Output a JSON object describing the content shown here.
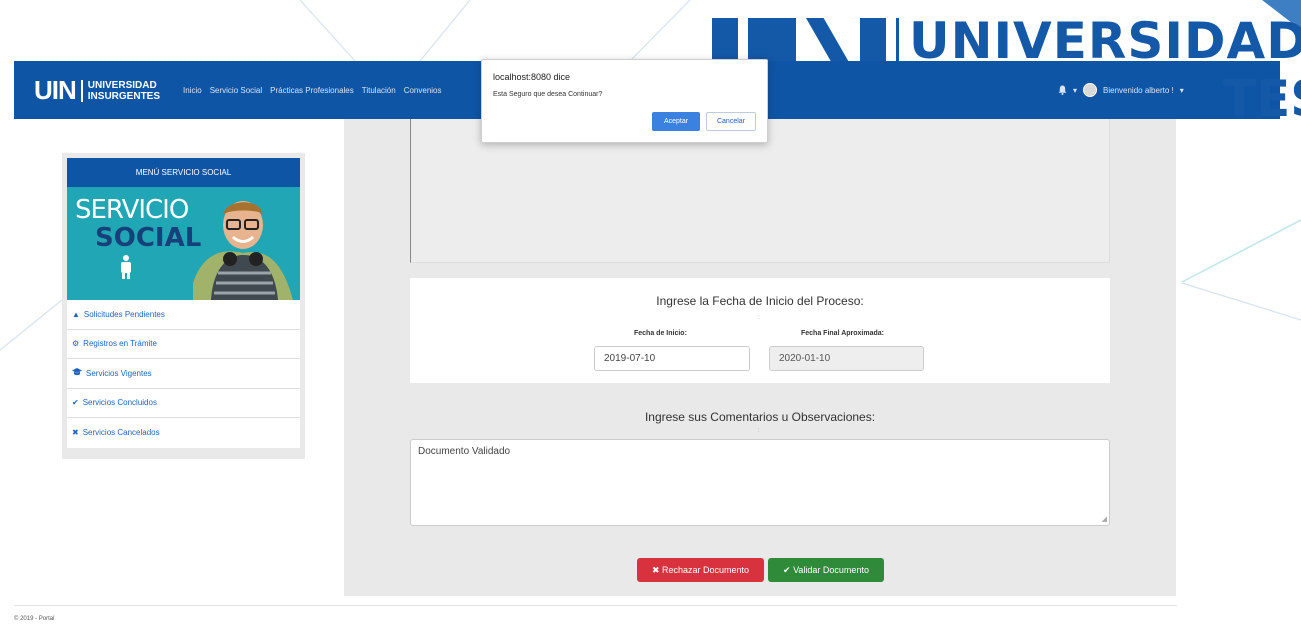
{
  "watermark": {
    "brand_top": "UNIVERSIDAD",
    "brand_bottom": "TES"
  },
  "navbar": {
    "logo_main": "UIN",
    "logo_line1": "UNIVERSIDAD",
    "logo_line2": "INSURGENTES",
    "links": [
      "Inicio",
      "Servicio Social",
      "Prácticas Profesionales",
      "Titulación",
      "Convenios"
    ],
    "bell_icon": "bell-icon",
    "caret": "▾",
    "user_label": "Bienvenido alberto !"
  },
  "dialog": {
    "title": "localhost:8080 dice",
    "message": "Esta Seguro que desea Continuar?",
    "accept_label": "Aceptar",
    "cancel_label": "Cancelar"
  },
  "sidebar": {
    "header": "MENÚ SERVICIO SOCIAL",
    "banner_line1": "SERVICIO",
    "banner_line2": "SOCIAL",
    "items": [
      {
        "icon": "warning-icon",
        "glyph": "▲",
        "label": "Solicitudes Pendientes"
      },
      {
        "icon": "cogs-icon",
        "glyph": "⚙",
        "label": "Registros en Trámite"
      },
      {
        "icon": "graduation-cap-icon",
        "glyph": "🎓",
        "label": "Servicios Vigentes"
      },
      {
        "icon": "check-icon",
        "glyph": "✔",
        "label": "Servicios Concluidos"
      },
      {
        "icon": "times-icon",
        "glyph": "✖",
        "label": "Servicios Cancelados"
      }
    ]
  },
  "main": {
    "date_section_title": "Ingrese la Fecha de Inicio del Proceso:",
    "start_label": "Fecha de Inicio:",
    "start_value": "2019-07-10",
    "end_label": "Fecha Final Aproximada:",
    "end_value": "2020-01-10",
    "comments_title": "Ingrese sus Comentarios u Observaciones:",
    "comments_value": "Documento Validado",
    "reject_label": "Rechazar Documento",
    "validate_label": "Validar Documento",
    "colon": ":"
  },
  "footer": {
    "text": "© 2019 - Portal"
  },
  "colors": {
    "navbar": "#0f55a6",
    "reject": "#d9323f",
    "validate": "#2f8a3a",
    "accept": "#3b82e0",
    "banner": "#21a6b5"
  }
}
